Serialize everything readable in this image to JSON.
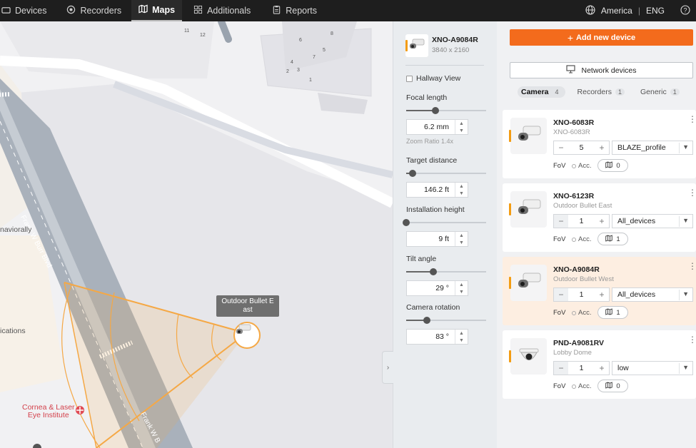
{
  "nav": {
    "tabs": [
      {
        "label": "Devices",
        "icon": "camera-icon"
      },
      {
        "label": "Recorders",
        "icon": "record-icon"
      },
      {
        "label": "Maps",
        "icon": "map-icon"
      },
      {
        "label": "Additionals",
        "icon": "grid-icon"
      },
      {
        "label": "Reports",
        "icon": "clipboard-icon"
      }
    ],
    "active_tab": "Maps",
    "region": "America",
    "language": "ENG"
  },
  "map": {
    "street_label": "Frank W Burr Blvd",
    "street_label_2": "Frank W B",
    "edge_label_1": "naviorally",
    "edge_label_2": "ications",
    "poi_label": "Cornea & Laser\nEye Institute",
    "building_numbers": [
      "11",
      "12",
      "6",
      "5",
      "4",
      "3",
      "2",
      "1",
      "8",
      "7"
    ],
    "tooltip": "Outdoor Bullet E\nast",
    "fov_color": "#f5a845"
  },
  "config": {
    "device_name": "XNO-A9084R",
    "resolution": "3840 x 2160",
    "hallway_label": "Hallway View",
    "focal": {
      "label": "Focal length",
      "value": "6.2 mm",
      "level": 0.37,
      "note": "Zoom Ratio 1.4x"
    },
    "target": {
      "label": "Target distance",
      "value": "146.2 ft",
      "level": 0.08
    },
    "height": {
      "label": "Installation height",
      "value": "9 ft",
      "level": 0.0
    },
    "tilt": {
      "label": "Tilt angle",
      "value": "29 °",
      "level": 0.34
    },
    "rotation": {
      "label": "Camera rotation",
      "value": "83 °",
      "level": 0.26
    }
  },
  "devices": {
    "add_label": "Add new device",
    "network_label": "Network devices",
    "tabs": [
      {
        "label": "Camera",
        "count": "4"
      },
      {
        "label": "Recorders",
        "count": "1"
      },
      {
        "label": "Generic",
        "count": "1"
      }
    ],
    "accent": "#f36b1c",
    "fov_label": "FoV",
    "acc_label": "Acc.",
    "cards": [
      {
        "name": "XNO-6083R",
        "sub": "XNO-6083R",
        "qty": "5",
        "profile": "BLAZE_profile",
        "maps": "0",
        "type": "bullet"
      },
      {
        "name": "XNO-6123R",
        "sub": "Outdoor Bullet East",
        "qty": "1",
        "profile": "All_devices",
        "maps": "1",
        "type": "bullet"
      },
      {
        "name": "XNO-A9084R",
        "sub": "Outdoor Bullet West",
        "qty": "1",
        "profile": "All_devices",
        "maps": "1",
        "type": "bullet"
      },
      {
        "name": "PND-A9081RV",
        "sub": "Lobby Dome",
        "qty": "1",
        "profile": "low",
        "maps": "0",
        "type": "dome"
      }
    ]
  }
}
